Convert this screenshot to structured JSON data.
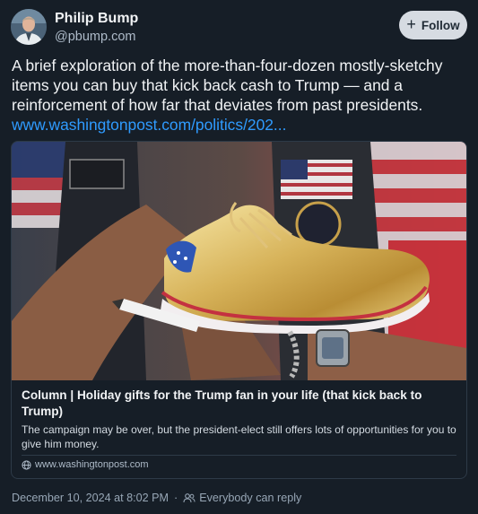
{
  "author": {
    "display_name": "Philip Bump",
    "handle": "@pbump.com",
    "avatar_icon": "person-avatar"
  },
  "follow_button": {
    "label": "Follow",
    "icon": "plus-icon"
  },
  "post": {
    "text": "A brief exploration of the more-than-four-dozen mostly-sketchy items you can buy that kick back cash to Trump — and a reinforcement of how far that deviates from past presidents.",
    "link_text": "www.washingtonpost.com/politics/202..."
  },
  "link_card": {
    "image_description_icon": "gold-sneaker-photo",
    "title": "Column | Holiday gifts for the Trump fan in your life (that kick back to Trump)",
    "description": "The campaign may be over, but the president-elect still offers lots of opportunities for you to give him money.",
    "domain": "www.washingtonpost.com",
    "domain_icon": "globe-icon"
  },
  "footer": {
    "timestamp": "December 10, 2024 at 8:02 PM",
    "separator": "·",
    "reply_setting": "Everybody can reply",
    "reply_icon": "people-icon"
  },
  "colors": {
    "background": "#161e27",
    "link": "#2f9bff",
    "follow_bg": "#d6dbe2",
    "muted_text": "#97a6b5"
  }
}
